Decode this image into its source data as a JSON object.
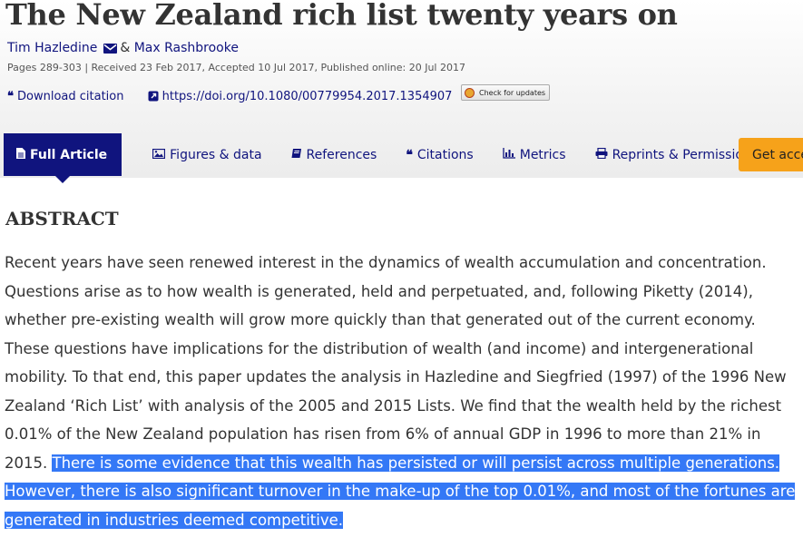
{
  "article": {
    "title": "The New Zealand rich list twenty years on",
    "author1": "Tim Hazledine",
    "author_sep": "& ",
    "author2": "Max Rashbrooke",
    "pub_info": "Pages 289-303 | Received 23 Feb 2017, Accepted 10 Jul 2017, Published online: 20 Jul 2017"
  },
  "actions": {
    "download_citation": "Download citation",
    "doi": "https://doi.org/10.1080/00779954.2017.1354907",
    "check_updates": "Check for updates"
  },
  "tabs": [
    {
      "label": "Full Article",
      "icon": "document-icon"
    },
    {
      "label": "Figures & data",
      "icon": "image-icon"
    },
    {
      "label": "References",
      "icon": "book-icon"
    },
    {
      "label": "Citations",
      "icon": "quote-icon"
    },
    {
      "label": "Metrics",
      "icon": "bar-chart-icon"
    },
    {
      "label": "Reprints & Permissions",
      "icon": "printer-icon"
    }
  ],
  "get_access": "Get access",
  "abstract": {
    "heading": "ABSTRACT",
    "text": "Recent years have seen renewed interest in the dynamics of wealth accumulation and concentration. Questions arise as to how wealth is generated, held and perpetuated, and, following Piketty (2014), whether pre-existing wealth will grow more quickly than that generated out of the current economy. These questions have implications for the distribution of wealth (and income) and intergenerational mobility. To that end, this paper updates the analysis in Hazledine and Siegfried (1997) of the 1996 New Zealand ‘Rich List’ with analysis of the 2005 and 2015 Lists. We find that the wealth held by the richest 0.01% of the New Zealand population has risen from 6% of annual GDP in 1996 to more than 21% in 2015. ",
    "selected_text": "There is some evidence that this wealth has persisted or will persist across multiple generations. However, there is also significant turnover in the make-up of the top 0.01%, and most of the fortunes are generated in industries deemed competitive."
  },
  "colors": {
    "brand_navy": "#10147e",
    "access_orange": "#f6a21a",
    "selection_blue": "#3478f6"
  }
}
